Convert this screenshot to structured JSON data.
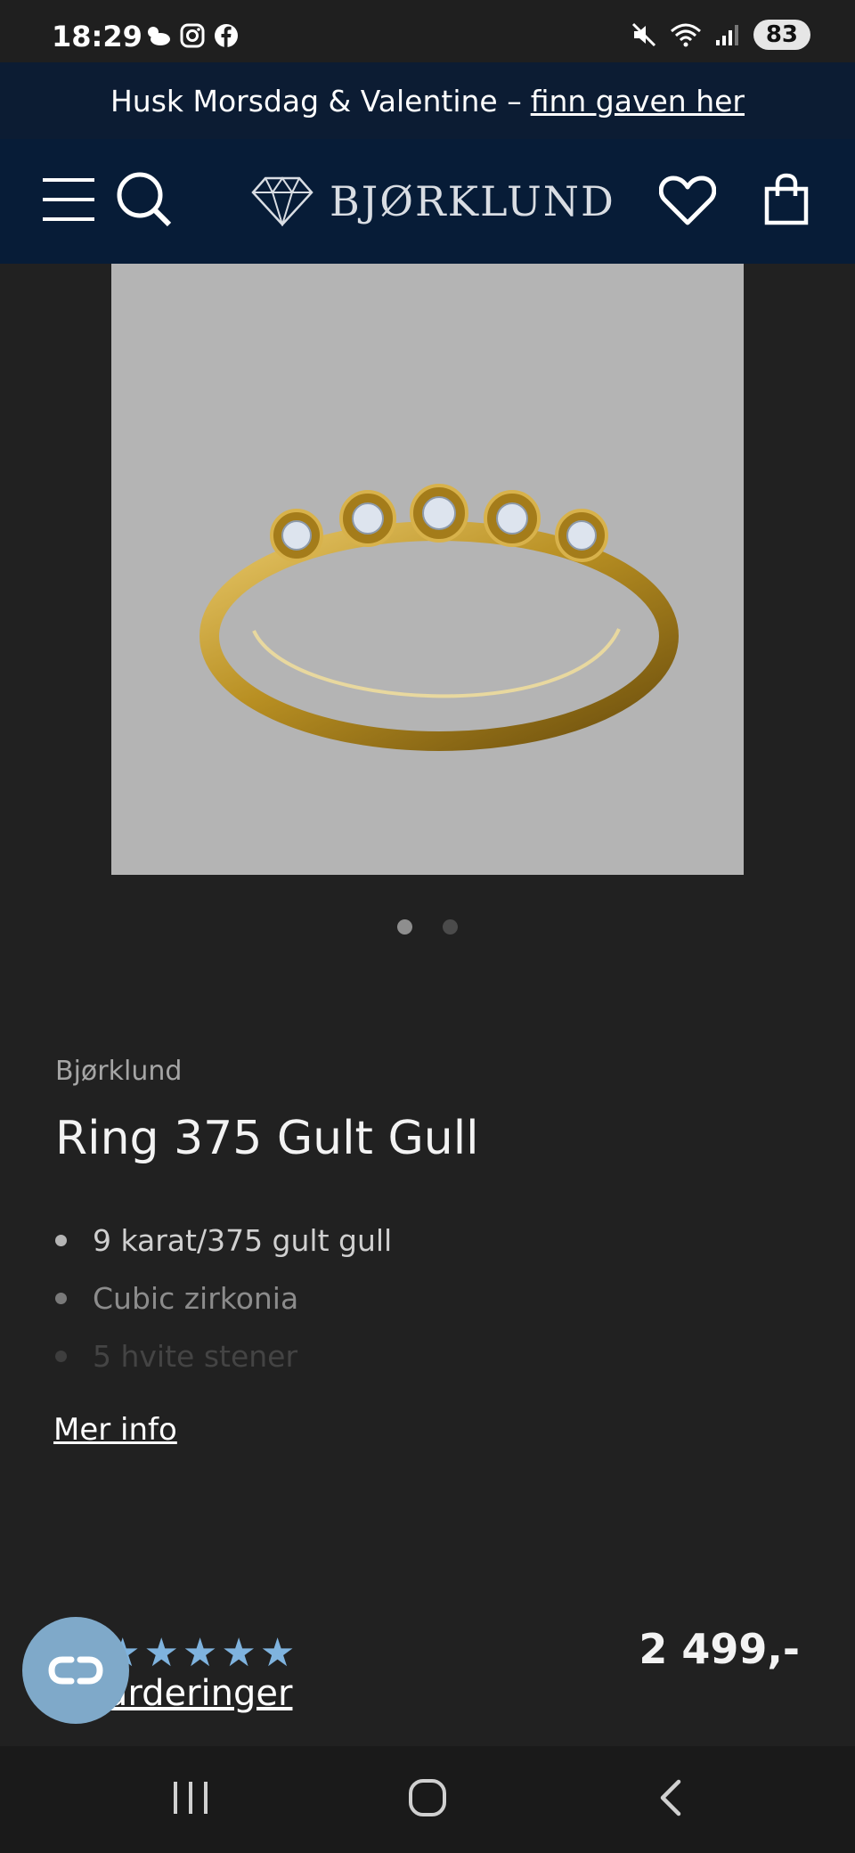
{
  "status": {
    "time": "18:29",
    "battery": "83"
  },
  "promo": {
    "text": "Husk Morsdag & Valentine –",
    "link": "finn gaven her"
  },
  "header": {
    "logo_text": "BJØRKLUND"
  },
  "gallery": {
    "active_index": 1,
    "count": 2
  },
  "product": {
    "brand": "Bjørklund",
    "title": "Ring 375 Gult Gull",
    "features": [
      "9 karat/375 gult gull",
      "Cubic zirkonia",
      "5 hvite stener"
    ],
    "more_info": "Mer info",
    "rating_stars": 5,
    "reviews_label": "urderinger",
    "price": "2 499,-"
  },
  "colors": {
    "accent": "#7fb3de",
    "header_bg": "#071c37",
    "promo_bg": "#0c1c33",
    "page_bg": "#212121"
  }
}
